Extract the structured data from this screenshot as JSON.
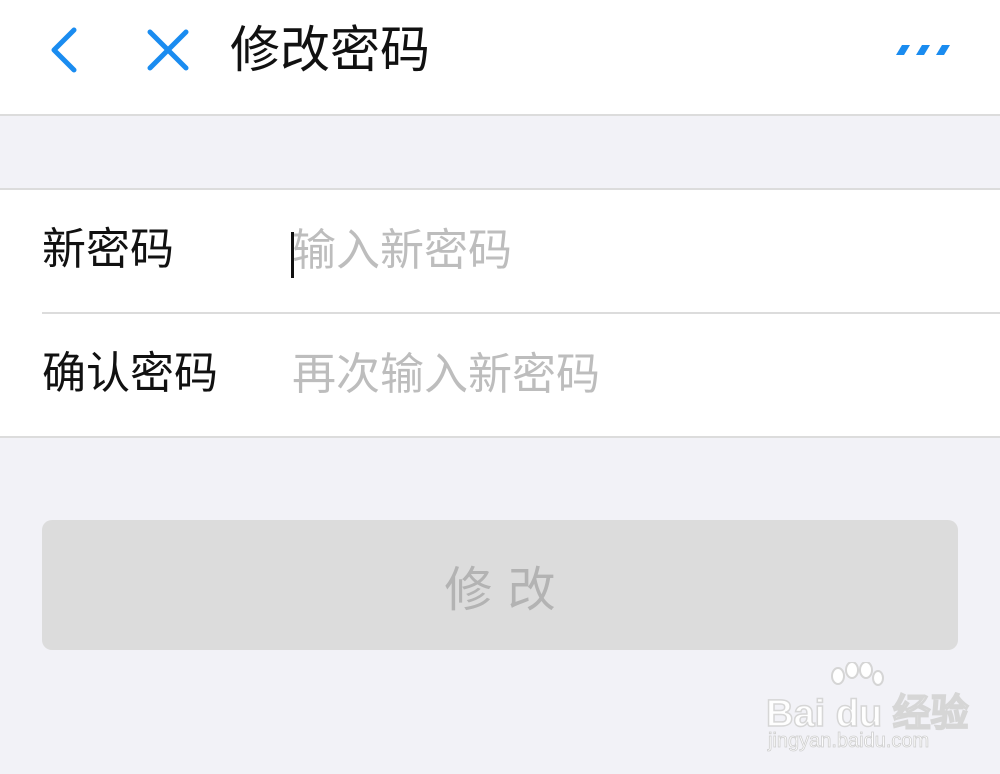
{
  "navbar": {
    "title": "修改密码",
    "back_icon": "chevron-left-icon",
    "close_icon": "close-icon",
    "more_icon": "more-dots-icon",
    "accent_color": "#1a8cf0"
  },
  "form": {
    "new_password": {
      "label": "新密码",
      "placeholder": "输入新密码",
      "value": ""
    },
    "confirm_password": {
      "label": "确认密码",
      "placeholder": "再次输入新密码",
      "value": ""
    }
  },
  "submit": {
    "label": "修 改",
    "state": "disabled"
  },
  "watermark": {
    "brand": "Bai du 经验",
    "url": "jingyan.baidu.com"
  }
}
